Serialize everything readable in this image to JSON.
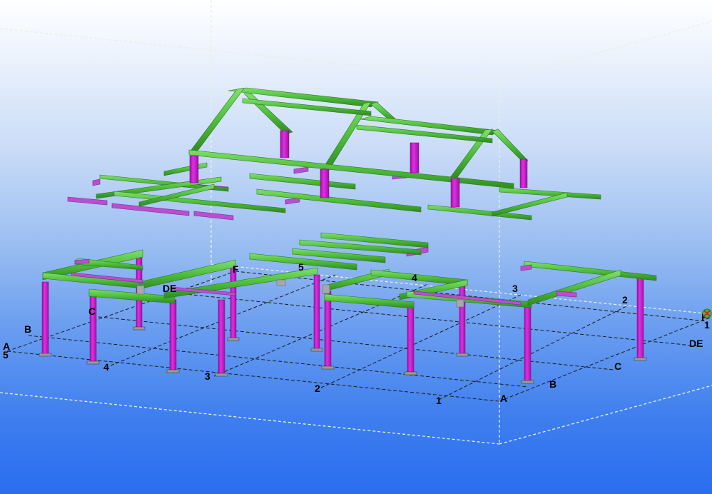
{
  "view": {
    "background_top": "#ffffff",
    "background_bottom": "#2a6df0"
  },
  "colors": {
    "beam": "#4fbd3c",
    "beam_dark": "#2e8a22",
    "column": "#d21ad2",
    "column_dark": "#a010a8",
    "secondary_member": "#b94fd0",
    "grid_line": "#1a1a1a",
    "box_line": "#e8f0e0"
  },
  "grid_labels": {
    "left_A": "A",
    "left_5": "5",
    "left_B": "B",
    "left_C": "C",
    "left_DE": "DE",
    "left_F": "F",
    "front_4": "4",
    "front_3": "3",
    "front_2": "2",
    "front_1": "1",
    "front_A": "A",
    "right_B": "B",
    "right_C": "C",
    "right_DE": "DE",
    "right_F": "F",
    "right_1": "1",
    "back_5": "5",
    "back_4": "4",
    "back_3": "3",
    "back_2": "2"
  },
  "icons": {
    "origin": "work-plane-origin-icon"
  }
}
